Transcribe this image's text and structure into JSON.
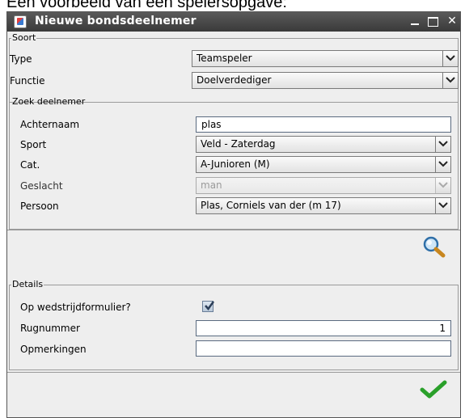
{
  "caption": "Een voorbeeld van een spelersopgave:",
  "window": {
    "title": "Nieuwe bondsdeelnemer",
    "icons": {
      "app": "java-cup-icon",
      "minimize": "minimize-icon",
      "maximize": "maximize-icon",
      "close": "close-icon"
    },
    "close_glyph": "✕"
  },
  "soort": {
    "legend": "Soort",
    "type_label": "Type",
    "type_value": "Teamspeler",
    "functie_label": "Functie",
    "functie_value": "Doelverdediger"
  },
  "zoek": {
    "legend": "Zoek deelnemer",
    "achternaam_label": "Achternaam",
    "achternaam_value": "plas",
    "sport_label": "Sport",
    "sport_value": "Veld - Zaterdag",
    "cat_label": "Cat.",
    "cat_value": "A-Junioren (M)",
    "geslacht_label": "Geslacht",
    "geslacht_value": "man",
    "persoon_label": "Persoon",
    "persoon_value": "Plas, Corniels van der (m 17)",
    "search_icon": "magnifier-icon"
  },
  "details": {
    "legend": "Details",
    "formulier_label": "Op wedstrijdformulier?",
    "formulier_checked": true,
    "rugnummer_label": "Rugnummer",
    "rugnummer_value": "1",
    "opmerkingen_label": "Opmerkingen",
    "opmerkingen_value": ""
  },
  "footer": {
    "confirm_icon": "checkmark-icon"
  },
  "colors": {
    "titlebar": "#4a4a4a",
    "checkmark": "#2aa02a"
  }
}
